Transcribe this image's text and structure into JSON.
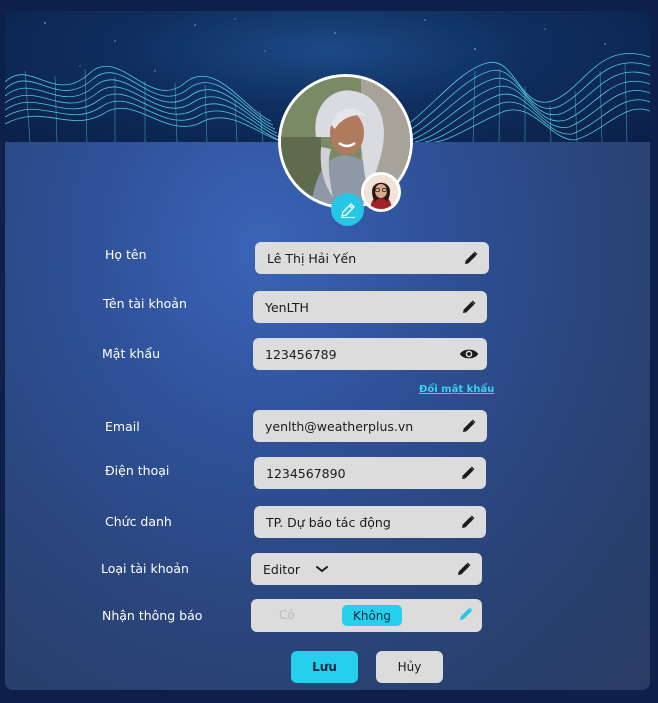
{
  "profile": {
    "change_password_link": "Đổi mật khẩu",
    "fields": [
      {
        "key": "name",
        "label": "Họ tên",
        "value": "Lê Thị Hải Yến",
        "icon": "pencil-icon"
      },
      {
        "key": "username",
        "label": "Tên tài khoản",
        "value": "YenLTH",
        "icon": "pencil-icon"
      },
      {
        "key": "password",
        "label": "Mật khẩu",
        "value": "123456789",
        "icon": "eye-icon"
      },
      {
        "key": "email",
        "label": "Email",
        "value": "yenlth@weatherplus.vn",
        "icon": "pencil-icon"
      },
      {
        "key": "phone",
        "label": "Điện thoại",
        "value": "1234567890",
        "icon": "pencil-icon"
      },
      {
        "key": "title",
        "label": "Chức danh",
        "value": "TP. Dự báo tác động",
        "icon": "pencil-icon"
      },
      {
        "key": "account_type",
        "label": "Loại tài khoản",
        "value": "Editor",
        "icon": "pencil-icon"
      }
    ],
    "notifications": {
      "label": "Nhận thông báo",
      "option_yes": "Có",
      "option_no": "Không",
      "selected": "Không"
    }
  },
  "actions": {
    "save_label": "Lưu",
    "cancel_label": "Hủy"
  },
  "colors": {
    "accent": "#26d0ec",
    "field_bg": "#dcdcdc",
    "panel_bg": "#2e4f95"
  }
}
